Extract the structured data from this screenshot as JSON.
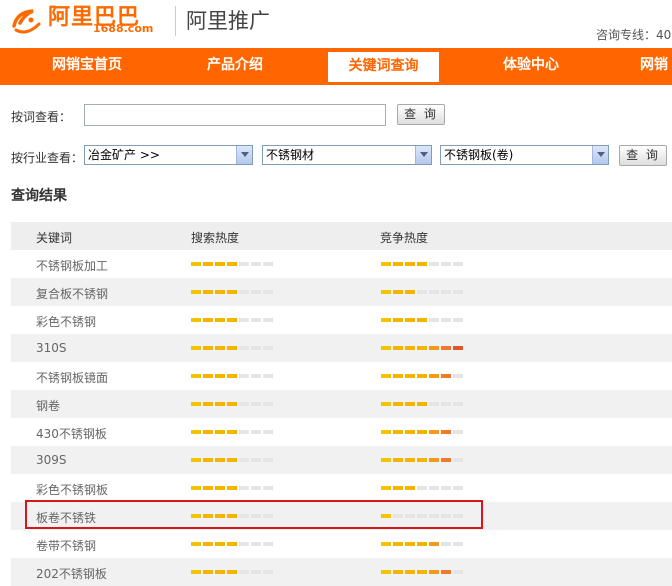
{
  "header": {
    "logo_text": "阿里巴巴",
    "logo_domain": "1688.com",
    "product_name": "阿里推广",
    "hotline": "咨询专线：40"
  },
  "colors": {
    "brand": "#ff6600",
    "highlight": "#d8151b"
  },
  "nav": {
    "items": [
      {
        "label": "网销宝首页",
        "active": false
      },
      {
        "label": "产品介绍",
        "active": false
      },
      {
        "label": "关键词查询",
        "active": true
      },
      {
        "label": "体验中心",
        "active": false
      },
      {
        "label": "网销",
        "active": false
      }
    ]
  },
  "search": {
    "keyword_label": "按词查看：",
    "keyword_value": "",
    "keyword_button": "查 询",
    "industry_label": "按行业查看：",
    "select1": "冶金矿产 >>",
    "select2": "不锈钢材",
    "select3": "不锈钢板(卷)",
    "industry_button": "查 询"
  },
  "results": {
    "title": "查询结果",
    "headers": {
      "keyword": "关键词",
      "search": "搜索热度",
      "compete": "竞争热度"
    },
    "rows": [
      {
        "keyword": "不锈钢板加工",
        "search_level": 4,
        "compete_level": 4
      },
      {
        "keyword": "复合板不锈钢",
        "search_level": 4,
        "compete_level": 3
      },
      {
        "keyword": "彩色不锈钢",
        "search_level": 4,
        "compete_level": 4
      },
      {
        "keyword": "310S",
        "search_level": 4,
        "compete_level": 7
      },
      {
        "keyword": "不锈钢板镜面",
        "search_level": 4,
        "compete_level": 6
      },
      {
        "keyword": "钢卷",
        "search_level": 4,
        "compete_level": 4
      },
      {
        "keyword": "430不锈钢板",
        "search_level": 4,
        "compete_level": 6
      },
      {
        "keyword": "309S",
        "search_level": 4,
        "compete_level": 6
      },
      {
        "keyword": "彩色不锈钢板",
        "search_level": 4,
        "compete_level": 3
      },
      {
        "keyword": "板卷不锈铁",
        "search_level": 4,
        "compete_level": 1
      },
      {
        "keyword": "卷带不锈钢",
        "search_level": 4,
        "compete_level": 5
      },
      {
        "keyword": "202不锈钢板",
        "search_level": 4,
        "compete_level": 6
      }
    ]
  }
}
